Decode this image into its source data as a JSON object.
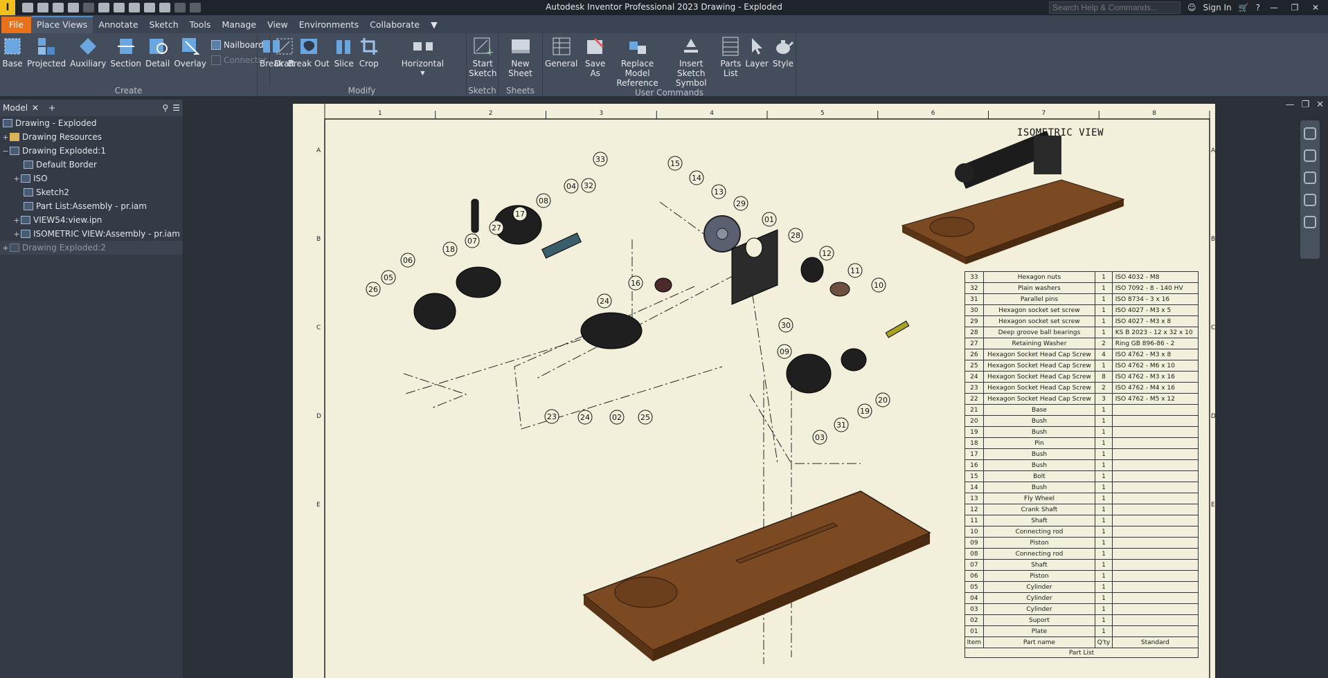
{
  "titlebar": {
    "app_letter": "I",
    "title": "Autodesk Inventor Professional 2023    Drawing - Exploded",
    "search_placeholder": "Search Help & Commands...",
    "sign_in": "Sign In"
  },
  "tabs": [
    "File",
    "Place Views",
    "Annotate",
    "Sketch",
    "Tools",
    "Manage",
    "View",
    "Environments",
    "Collaborate"
  ],
  "ribbon": {
    "create": {
      "label": "Create",
      "buttons": [
        "Base",
        "Projected",
        "Auxiliary",
        "Section",
        "Detail",
        "Overlay"
      ],
      "small": [
        "Nailboard",
        "Connector"
      ],
      "draft": "Draft"
    },
    "modify": {
      "label": "Modify",
      "buttons": [
        "Break",
        "Break Out",
        "Slice",
        "Crop"
      ],
      "horizontal": "Horizontal"
    },
    "sketch": {
      "label": "Sketch",
      "start": "Start",
      "start2": "Sketch"
    },
    "sheets": {
      "label": "Sheets",
      "new_sheet": "New Sheet"
    },
    "user": {
      "label": "User Commands",
      "general": "General",
      "save_as": "Save As",
      "replace1": "Replace Model",
      "replace2": "Reference",
      "insert1": "Insert",
      "insert2": "Sketch Symbol",
      "parts1": "Parts",
      "parts2": "List",
      "layer": "Layer",
      "style": "Style"
    }
  },
  "browser": {
    "tab": "Model",
    "items": [
      {
        "label": "Drawing - Exploded",
        "exp": ""
      },
      {
        "label": "Drawing Resources",
        "exp": "+"
      },
      {
        "label": "Drawing Exploded:1",
        "exp": "−"
      },
      {
        "label": "Default Border",
        "exp": ""
      },
      {
        "label": "ISO",
        "exp": "+"
      },
      {
        "label": "Sketch2",
        "exp": ""
      },
      {
        "label": "Part List:Assembly - pr.iam",
        "exp": ""
      },
      {
        "label": "VIEW54:view.ipn",
        "exp": "+"
      },
      {
        "label": "ISOMETRIC VIEW:Assembly - pr.iam",
        "exp": "+"
      },
      {
        "label": "Drawing Exploded:2",
        "exp": "+"
      }
    ]
  },
  "sheet": {
    "iso_title": "ISOMETRIC VIEW",
    "col_numbers": [
      "1",
      "2",
      "3",
      "4",
      "5",
      "6",
      "7",
      "8"
    ],
    "row_letters": [
      "A",
      "B",
      "C",
      "D",
      "E"
    ],
    "balloons": [
      "33",
      "32",
      "15",
      "14",
      "13",
      "29",
      "04",
      "08",
      "17",
      "27",
      "18",
      "07",
      "06",
      "05",
      "26",
      "01",
      "28",
      "12",
      "11",
      "10",
      "30",
      "16",
      "24",
      "09",
      "19",
      "20",
      "31",
      "03",
      "23",
      "24",
      "02",
      "25"
    ]
  },
  "parts_list": {
    "title": "Part List",
    "headers": [
      "Item",
      "Part name",
      "Q'ty",
      "Standard"
    ],
    "rows": [
      [
        "33",
        "Hexagon nuts",
        "1",
        "ISO 4032 - M8"
      ],
      [
        "32",
        "Plain washers",
        "1",
        "ISO 7092 - 8 - 140 HV"
      ],
      [
        "31",
        "Parallel pins",
        "1",
        "ISO 8734 - 3 x 16"
      ],
      [
        "30",
        "Hexagon socket set screw",
        "1",
        "ISO 4027 - M3 x 5"
      ],
      [
        "29",
        "Hexagon socket set screw",
        "1",
        "ISO 4027 - M3 x 8"
      ],
      [
        "28",
        "Deep groove ball bearings",
        "1",
        "KS B 2023 - 12 x 32 x 10"
      ],
      [
        "27",
        "Retaining Washer",
        "2",
        "Ring GB 896-86 - 2"
      ],
      [
        "26",
        "Hexagon Socket Head Cap Screw",
        "4",
        "ISO 4762 - M3 x 8"
      ],
      [
        "25",
        "Hexagon Socket Head Cap Screw",
        "1",
        "ISO 4762 - M6 x 10"
      ],
      [
        "24",
        "Hexagon Socket Head Cap Screw",
        "8",
        "ISO 4762 - M3 x 16"
      ],
      [
        "23",
        "Hexagon Socket Head Cap Screw",
        "2",
        "ISO 4762 - M4 x 16"
      ],
      [
        "22",
        "Hexagon Socket Head Cap Screw",
        "3",
        "ISO 4762 - M5 x 12"
      ],
      [
        "21",
        "Base",
        "1",
        ""
      ],
      [
        "20",
        "Bush",
        "1",
        ""
      ],
      [
        "19",
        "Bush",
        "1",
        ""
      ],
      [
        "18",
        "Pin",
        "1",
        ""
      ],
      [
        "17",
        "Bush",
        "1",
        ""
      ],
      [
        "16",
        "Bush",
        "1",
        ""
      ],
      [
        "15",
        "Bolt",
        "1",
        ""
      ],
      [
        "14",
        "Bush",
        "1",
        ""
      ],
      [
        "13",
        "Fly Wheel",
        "1",
        ""
      ],
      [
        "12",
        "Crank Shaft",
        "1",
        ""
      ],
      [
        "11",
        "Shaft",
        "1",
        ""
      ],
      [
        "10",
        "Connecting rod",
        "1",
        ""
      ],
      [
        "09",
        "Piston",
        "1",
        ""
      ],
      [
        "08",
        "Connecting rod",
        "1",
        ""
      ],
      [
        "07",
        "Shaft",
        "1",
        ""
      ],
      [
        "06",
        "Piston",
        "1",
        ""
      ],
      [
        "05",
        "Cylinder",
        "1",
        ""
      ],
      [
        "04",
        "Cylinder",
        "1",
        ""
      ],
      [
        "03",
        "Cylinder",
        "1",
        ""
      ],
      [
        "02",
        "Suport",
        "1",
        ""
      ],
      [
        "01",
        "Plate",
        "1",
        ""
      ]
    ]
  }
}
